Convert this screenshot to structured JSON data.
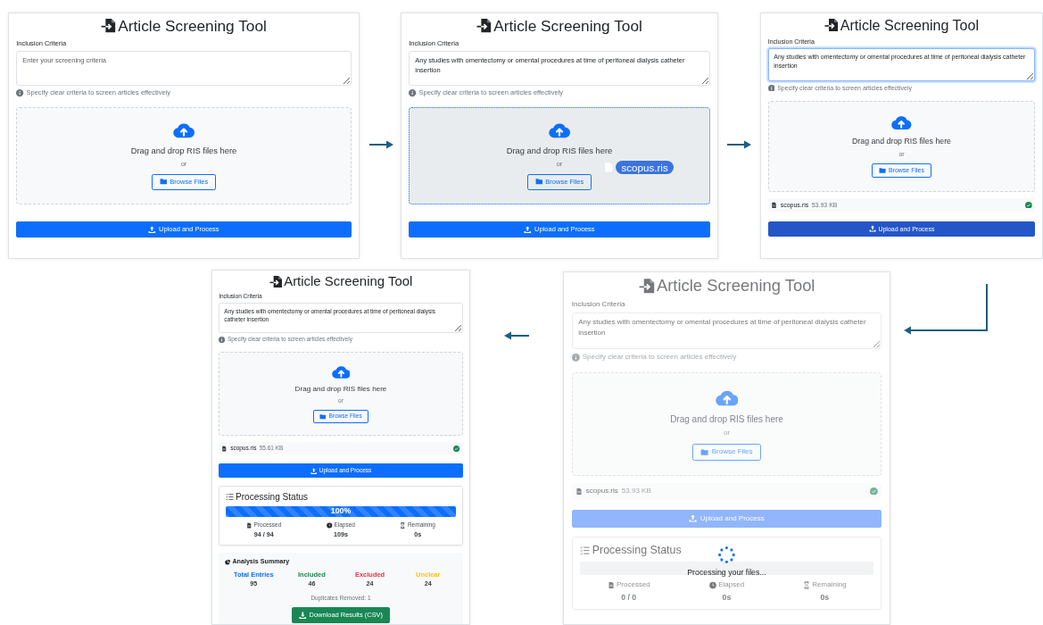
{
  "panels": [
    {
      "title": "Article Screening Tool",
      "criteria_label": "Inclusion Criteria",
      "criteria": {
        "placeholder": "Enter your screening criteria",
        "focused": false
      },
      "hint": "Specify clear criteria to screen articles effectively",
      "dropzone": {
        "text": "Drag and drop RIS files here",
        "or": "or",
        "browse": "Browse Files",
        "drag_over": false
      },
      "upload": {
        "label": "Upload and Process",
        "hovered": false,
        "disabled": false
      }
    },
    {
      "title": "Article Screening Tool",
      "criteria_label": "Inclusion Criteria",
      "criteria": {
        "value": "Any studies with omentectomy or omental procedures at time of peritoneal dialysis catheter insertion",
        "focused": false
      },
      "hint": "Specify clear criteria to screen articles effectively",
      "dropzone": {
        "text": "Drag and drop RIS files here",
        "or": "or",
        "browse": "Browse Files",
        "drag_over": true,
        "dragged_file": "scopus.ris"
      },
      "upload": {
        "label": "Upload and Process",
        "hovered": false,
        "disabled": false
      }
    },
    {
      "title": "Article Screening Tool",
      "criteria_label": "Inclusion Criteria",
      "criteria": {
        "value": "Any studies with omentectomy or omental procedures at time of peritoneal dialysis catheter insertion",
        "focused": true
      },
      "hint": "Specify clear criteria to screen articles effectively",
      "dropzone": {
        "text": "Drag and drop RIS files here",
        "or": "or",
        "browse": "Browse Files",
        "drag_over": false
      },
      "file": {
        "name": "scopus.ris",
        "size": "53.93 KB"
      },
      "upload": {
        "label": "Upload and Process",
        "hovered": true,
        "disabled": false
      }
    },
    {
      "title": "Article Screening Tool",
      "criteria_label": "Inclusion Criteria",
      "criteria": {
        "value": "Any studies with omentectomy or omental procedures at time of peritoneal dialysis catheter insertion",
        "focused": false
      },
      "hint": "Specify clear criteria to screen articles effectively",
      "dropzone": {
        "text": "Drag and drop RIS files here",
        "or": "or",
        "browse": "Browse Files",
        "drag_over": false
      },
      "file": {
        "name": "scopus.ris",
        "size": "55.61 KB"
      },
      "upload": {
        "label": "Upload and Process",
        "hovered": false,
        "disabled": false
      },
      "status": {
        "title": "Processing Status",
        "level": 1,
        "progress_label": "100%",
        "stats": [
          {
            "label": "Processed",
            "value": "94 / 94"
          },
          {
            "label": "Elapsed",
            "value": "109s"
          },
          {
            "label": "Remaining",
            "value": "0s"
          }
        ]
      },
      "summary": {
        "title": "Analysis Summary",
        "stats": [
          {
            "label": "Total Entries",
            "value": "95",
            "color": "#0d6efd"
          },
          {
            "label": "Included",
            "value": "46",
            "color": "#198754"
          },
          {
            "label": "Excluded",
            "value": "24",
            "color": "#dc3545"
          },
          {
            "label": "Unclear",
            "value": "24",
            "color": "#ffc107"
          }
        ],
        "duplicates": "Duplicates Removed: 1",
        "download": "Download Results (CSV)"
      }
    },
    {
      "title": "Article Screening Tool",
      "criteria_label": "Inclusion Criteria",
      "criteria": {
        "value": "Any studies with omentectomy or omental procedures at time of peritoneal dialysis catheter insertion",
        "focused": false
      },
      "hint": "Specify clear criteria to screen articles effectively",
      "dropzone": {
        "text": "Drag and drop RIS files here",
        "or": "or",
        "browse": "Browse Files",
        "drag_over": false
      },
      "file": {
        "name": "scopus.ris",
        "size": "53.93 KB"
      },
      "upload": {
        "label": "Upload and Process",
        "hovered": false,
        "disabled": true
      },
      "status": {
        "title": "Processing Status",
        "level": 0,
        "stats": [
          {
            "label": "Processed",
            "value": "0 / 0"
          },
          {
            "label": "Elapsed",
            "value": "0s"
          },
          {
            "label": "Remaining",
            "value": "0s"
          }
        ]
      },
      "overlay": {
        "text": "Processing your files..."
      }
    }
  ]
}
